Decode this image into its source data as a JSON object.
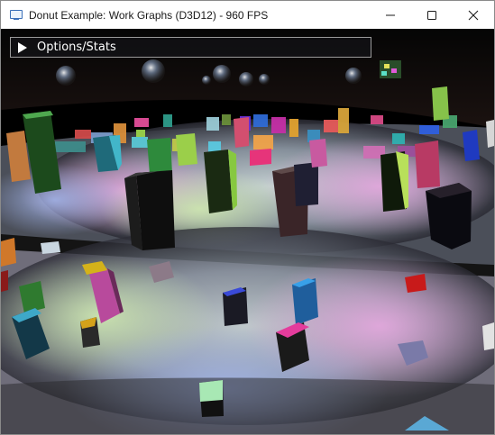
{
  "window": {
    "title": "Donut Example: Work Graphs (D3D12) - 960 FPS",
    "app_icon": "app-window-icon",
    "minimize_icon": "minimize-icon",
    "maximize_icon": "maximize-icon",
    "close_icon": "close-icon"
  },
  "panel": {
    "label": "Options/Stats",
    "expand_icon": "triangle-right-icon"
  },
  "colors": {
    "titlebar_bg": "#ffffff",
    "viewport_bg": "#000000",
    "panel_bg": "#141418",
    "panel_border": "#9a9a9a"
  }
}
